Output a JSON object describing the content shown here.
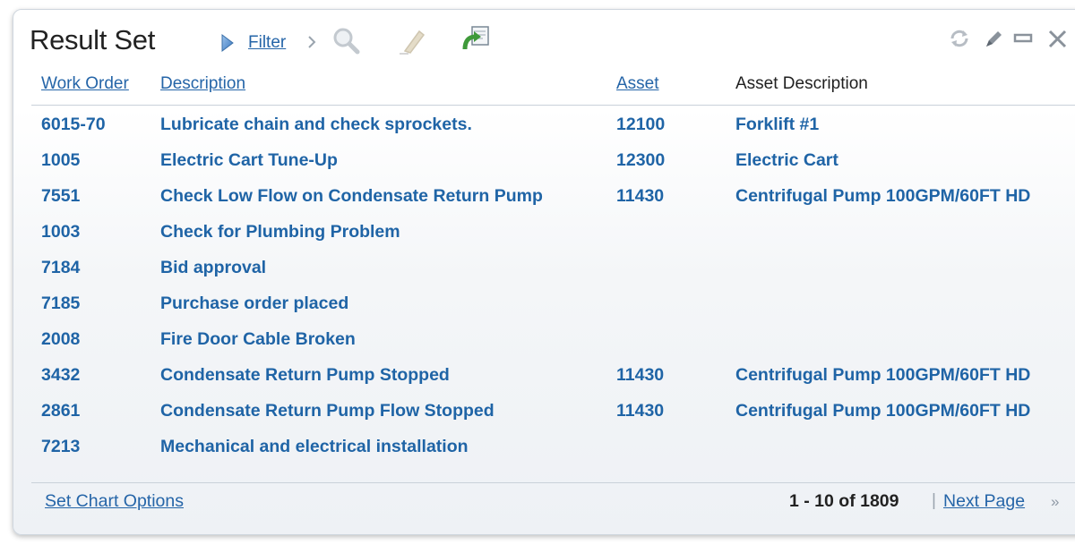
{
  "panel": {
    "title": "Result Set",
    "toolbar": {
      "filter_label": "Filter",
      "icons": [
        "play-arrow-icon",
        "chevron-right-icon",
        "magnifier-icon",
        "eraser-icon",
        "export-icon"
      ],
      "window_controls": [
        "refresh-icon",
        "edit-pencil-icon",
        "minimize-icon",
        "close-icon"
      ]
    },
    "columns": {
      "work_order": "Work Order",
      "description": "Description",
      "asset": "Asset",
      "asset_description": "Asset Description"
    },
    "rows": [
      {
        "work_order": "6015-70",
        "description": "Lubricate chain and check sprockets.",
        "asset": "12100",
        "asset_description": "Forklift #1"
      },
      {
        "work_order": "1005",
        "description": "Electric Cart Tune-Up",
        "asset": "12300",
        "asset_description": "Electric Cart"
      },
      {
        "work_order": "7551",
        "description": "Check Low Flow on Condensate Return Pump",
        "asset": "11430",
        "asset_description": "Centrifugal Pump 100GPM/60FT HD"
      },
      {
        "work_order": "1003",
        "description": "Check for Plumbing Problem",
        "asset": "",
        "asset_description": ""
      },
      {
        "work_order": "7184",
        "description": "Bid approval",
        "asset": "",
        "asset_description": ""
      },
      {
        "work_order": "7185",
        "description": "Purchase order placed",
        "asset": "",
        "asset_description": ""
      },
      {
        "work_order": "2008",
        "description": "Fire Door Cable Broken",
        "asset": "",
        "asset_description": ""
      },
      {
        "work_order": "3432",
        "description": "Condensate Return Pump Stopped",
        "asset": "11430",
        "asset_description": "Centrifugal Pump 100GPM/60FT HD"
      },
      {
        "work_order": "2861",
        "description": "Condensate Return Pump Flow Stopped",
        "asset": "11430",
        "asset_description": "Centrifugal Pump 100GPM/60FT HD"
      },
      {
        "work_order": "7213",
        "description": "Mechanical and electrical installation",
        "asset": "",
        "asset_description": ""
      }
    ],
    "footer": {
      "chart_options": "Set Chart Options",
      "count": "1 - 10 of 1809",
      "separator": "|",
      "next_page": "Next Page",
      "next_arrows": "»"
    },
    "colors": {
      "link": "#2565a8",
      "row_text": "#1f64a6",
      "border": "#c9d1da"
    }
  }
}
